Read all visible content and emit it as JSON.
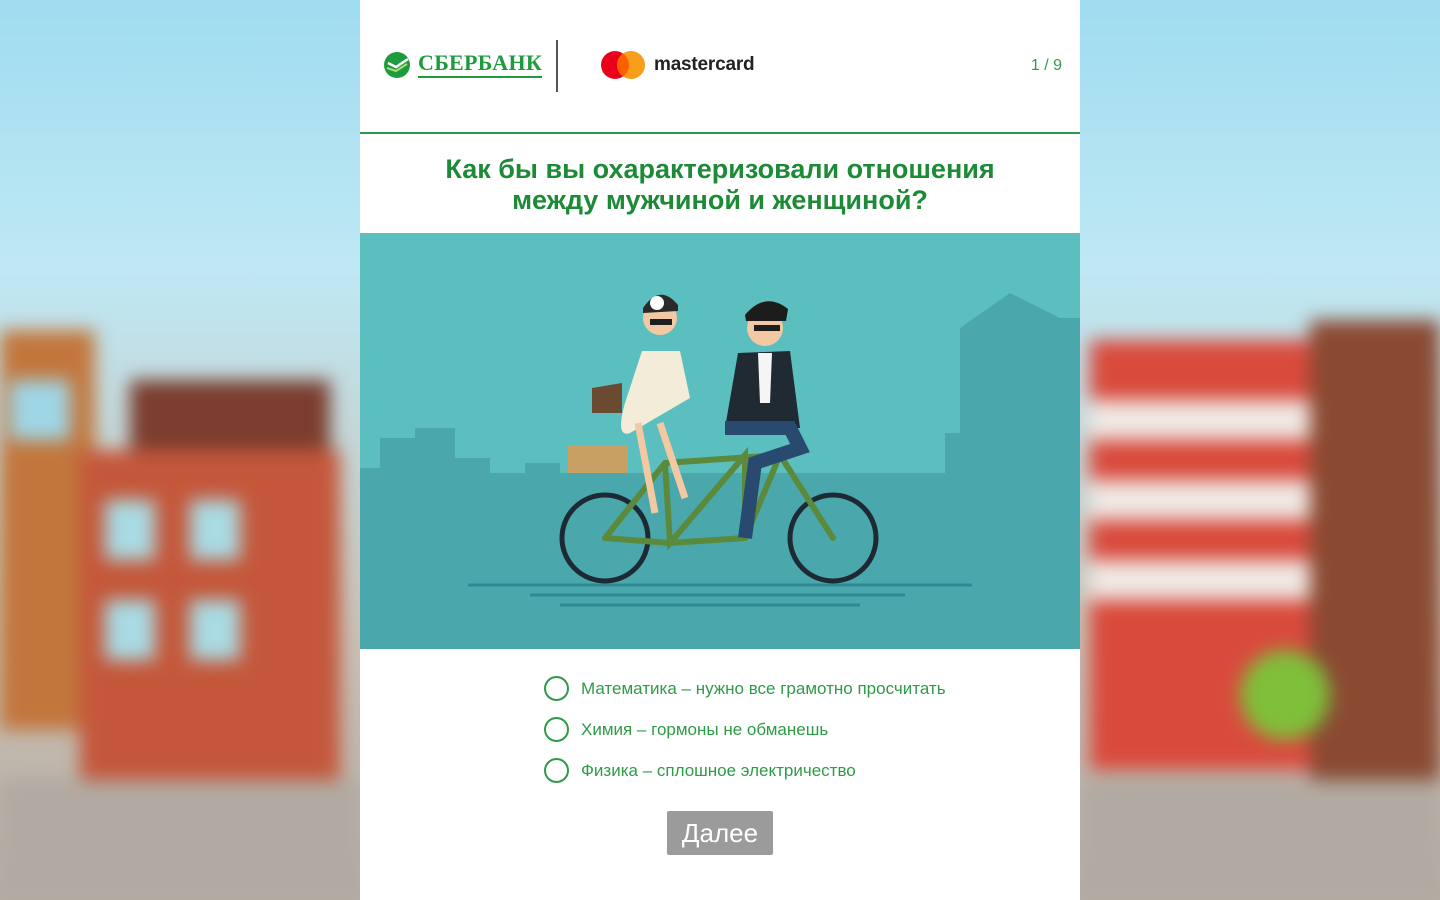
{
  "header": {
    "bank_logo_text": "СБЕРБАНК",
    "partner_logo_text": "mastercard",
    "progress": "1 / 9"
  },
  "question": {
    "line1": "Как бы вы охарактеризовали отношения",
    "line2": "между мужчиной и женщиной?"
  },
  "illustration": {
    "subject": "tandem-bicycle-couple"
  },
  "options": [
    {
      "label": "Математика – нужно все грамотно просчитать",
      "selected": false
    },
    {
      "label": "Химия – гормоны не обманешь",
      "selected": false
    },
    {
      "label": "Физика – сплошное электричество",
      "selected": false
    }
  ],
  "next_button": {
    "label": "Далее",
    "enabled": false
  },
  "colors": {
    "brand_green": "#1e9b3c",
    "illustration_bg": "#5bbfbf",
    "button_disabled": "#9b9b9b"
  }
}
